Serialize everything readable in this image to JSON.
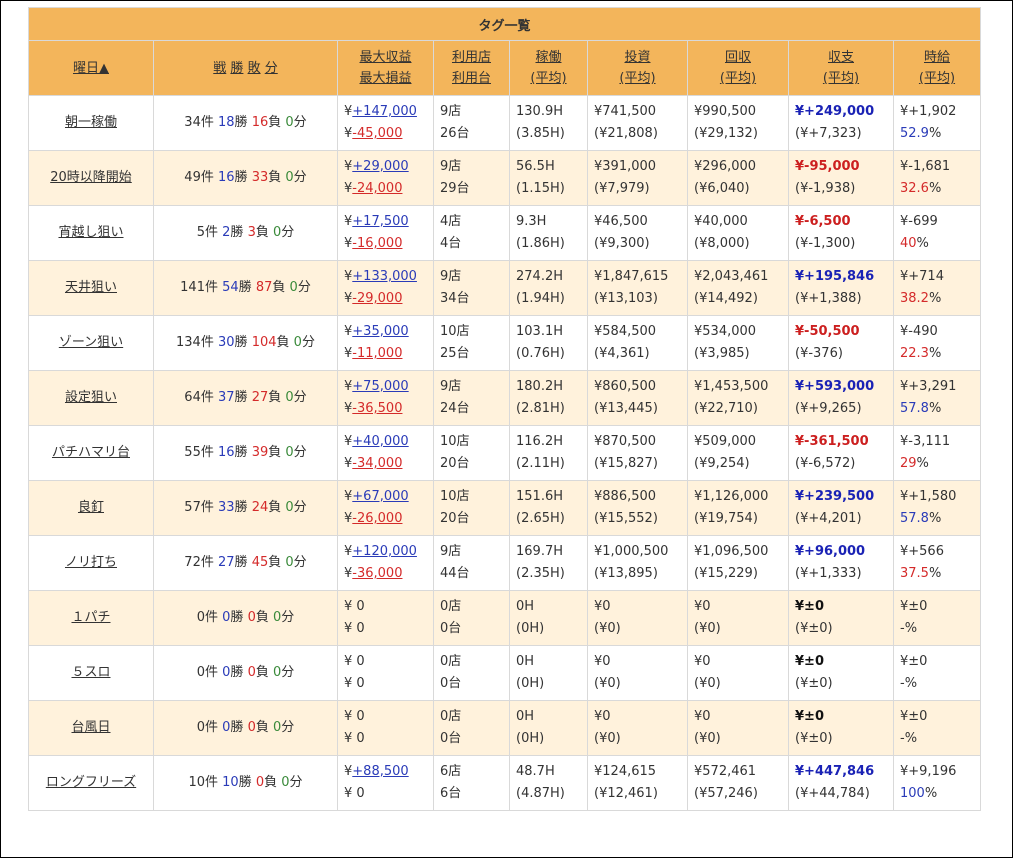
{
  "table_title": "タグ一覧",
  "headers": {
    "day": "曜日▲",
    "record": [
      "戦",
      "勝",
      "敗",
      "分"
    ],
    "max_profit": "最大収益",
    "max_loss": "最大損益",
    "shops": "利用店",
    "machines": "利用台",
    "hours": "稼働",
    "hours_avg": "(平均)",
    "invest": "投資",
    "invest_avg": "(平均)",
    "collect": "回収",
    "collect_avg": "(平均)",
    "balance": "収支",
    "balance_avg": "(平均)",
    "hourly": "時給",
    "hourly_avg": "(平均)"
  },
  "rows": [
    {
      "name": "朝一稼働",
      "games": "34件",
      "wins": "18",
      "losses": "16",
      "draws": "0",
      "max_p": "¥+147,000",
      "max_l": "¥-45,000",
      "shops": "9店",
      "machines": "26台",
      "hours": "130.9H",
      "hours_avg": "(3.85H)",
      "invest": "¥741,500",
      "invest_avg": "(¥21,808)",
      "collect": "¥990,500",
      "collect_avg": "(¥29,132)",
      "balance": "¥+249,000",
      "balance_avg": "(¥+7,323)",
      "hourly": "¥+1,902",
      "rate": "52.9"
    },
    {
      "name": "20時以降開始",
      "games": "49件",
      "wins": "16",
      "losses": "33",
      "draws": "0",
      "max_p": "¥+29,000",
      "max_l": "¥-24,000",
      "shops": "9店",
      "machines": "29台",
      "hours": "56.5H",
      "hours_avg": "(1.15H)",
      "invest": "¥391,000",
      "invest_avg": "(¥7,979)",
      "collect": "¥296,000",
      "collect_avg": "(¥6,040)",
      "balance": "¥-95,000",
      "balance_avg": "(¥-1,938)",
      "hourly": "¥-1,681",
      "rate": "32.6"
    },
    {
      "name": "宵越し狙い",
      "games": "5件",
      "wins": "2",
      "losses": "3",
      "draws": "0",
      "max_p": "¥+17,500",
      "max_l": "¥-16,000",
      "shops": "4店",
      "machines": "4台",
      "hours": "9.3H",
      "hours_avg": "(1.86H)",
      "invest": "¥46,500",
      "invest_avg": "(¥9,300)",
      "collect": "¥40,000",
      "collect_avg": "(¥8,000)",
      "balance": "¥-6,500",
      "balance_avg": "(¥-1,300)",
      "hourly": "¥-699",
      "rate": "40"
    },
    {
      "name": "天井狙い",
      "games": "141件",
      "wins": "54",
      "losses": "87",
      "draws": "0",
      "max_p": "¥+133,000",
      "max_l": "¥-29,000",
      "shops": "9店",
      "machines": "34台",
      "hours": "274.2H",
      "hours_avg": "(1.94H)",
      "invest": "¥1,847,615",
      "invest_avg": "(¥13,103)",
      "collect": "¥2,043,461",
      "collect_avg": "(¥14,492)",
      "balance": "¥+195,846",
      "balance_avg": "(¥+1,388)",
      "hourly": "¥+714",
      "rate": "38.2"
    },
    {
      "name": "ゾーン狙い",
      "games": "134件",
      "wins": "30",
      "losses": "104",
      "draws": "0",
      "max_p": "¥+35,000",
      "max_l": "¥-11,000",
      "shops": "10店",
      "machines": "25台",
      "hours": "103.1H",
      "hours_avg": "(0.76H)",
      "invest": "¥584,500",
      "invest_avg": "(¥4,361)",
      "collect": "¥534,000",
      "collect_avg": "(¥3,985)",
      "balance": "¥-50,500",
      "balance_avg": "(¥-376)",
      "hourly": "¥-490",
      "rate": "22.3"
    },
    {
      "name": "設定狙い",
      "games": "64件",
      "wins": "37",
      "losses": "27",
      "draws": "0",
      "max_p": "¥+75,000",
      "max_l": "¥-36,500",
      "shops": "9店",
      "machines": "24台",
      "hours": "180.2H",
      "hours_avg": "(2.81H)",
      "invest": "¥860,500",
      "invest_avg": "(¥13,445)",
      "collect": "¥1,453,500",
      "collect_avg": "(¥22,710)",
      "balance": "¥+593,000",
      "balance_avg": "(¥+9,265)",
      "hourly": "¥+3,291",
      "rate": "57.8"
    },
    {
      "name": "パチハマリ台",
      "games": "55件",
      "wins": "16",
      "losses": "39",
      "draws": "0",
      "max_p": "¥+40,000",
      "max_l": "¥-34,000",
      "shops": "10店",
      "machines": "20台",
      "hours": "116.2H",
      "hours_avg": "(2.11H)",
      "invest": "¥870,500",
      "invest_avg": "(¥15,827)",
      "collect": "¥509,000",
      "collect_avg": "(¥9,254)",
      "balance": "¥-361,500",
      "balance_avg": "(¥-6,572)",
      "hourly": "¥-3,111",
      "rate": "29"
    },
    {
      "name": "良釘",
      "games": "57件",
      "wins": "33",
      "losses": "24",
      "draws": "0",
      "max_p": "¥+67,000",
      "max_l": "¥-26,000",
      "shops": "10店",
      "machines": "20台",
      "hours": "151.6H",
      "hours_avg": "(2.65H)",
      "invest": "¥886,500",
      "invest_avg": "(¥15,552)",
      "collect": "¥1,126,000",
      "collect_avg": "(¥19,754)",
      "balance": "¥+239,500",
      "balance_avg": "(¥+4,201)",
      "hourly": "¥+1,580",
      "rate": "57.8"
    },
    {
      "name": "ノリ打ち",
      "games": "72件",
      "wins": "27",
      "losses": "45",
      "draws": "0",
      "max_p": "¥+120,000",
      "max_l": "¥-36,000",
      "shops": "9店",
      "machines": "44台",
      "hours": "169.7H",
      "hours_avg": "(2.35H)",
      "invest": "¥1,000,500",
      "invest_avg": "(¥13,895)",
      "collect": "¥1,096,500",
      "collect_avg": "(¥15,229)",
      "balance": "¥+96,000",
      "balance_avg": "(¥+1,333)",
      "hourly": "¥+566",
      "rate": "37.5"
    },
    {
      "name": "１パチ",
      "games": "0件",
      "wins": "0",
      "losses": "0",
      "draws": "0",
      "max_p": "¥ 0",
      "max_l": "¥ 0",
      "shops": "0店",
      "machines": "0台",
      "hours": "0H",
      "hours_avg": "(0H)",
      "invest": "¥0",
      "invest_avg": "(¥0)",
      "collect": "¥0",
      "collect_avg": "(¥0)",
      "balance": "¥±0",
      "balance_avg": "(¥±0)",
      "hourly": "¥±0",
      "rate": "-"
    },
    {
      "name": "５スロ",
      "games": "0件",
      "wins": "0",
      "losses": "0",
      "draws": "0",
      "max_p": "¥ 0",
      "max_l": "¥ 0",
      "shops": "0店",
      "machines": "0台",
      "hours": "0H",
      "hours_avg": "(0H)",
      "invest": "¥0",
      "invest_avg": "(¥0)",
      "collect": "¥0",
      "collect_avg": "(¥0)",
      "balance": "¥±0",
      "balance_avg": "(¥±0)",
      "hourly": "¥±0",
      "rate": "-"
    },
    {
      "name": "台風日",
      "games": "0件",
      "wins": "0",
      "losses": "0",
      "draws": "0",
      "max_p": "¥ 0",
      "max_l": "¥ 0",
      "shops": "0店",
      "machines": "0台",
      "hours": "0H",
      "hours_avg": "(0H)",
      "invest": "¥0",
      "invest_avg": "(¥0)",
      "collect": "¥0",
      "collect_avg": "(¥0)",
      "balance": "¥±0",
      "balance_avg": "(¥±0)",
      "hourly": "¥±0",
      "rate": "-"
    },
    {
      "name": "ロングフリーズ",
      "games": "10件",
      "wins": "10",
      "losses": "0",
      "draws": "0",
      "max_p": "¥+88,500",
      "max_l": "¥ 0",
      "shops": "6店",
      "machines": "6台",
      "hours": "48.7H",
      "hours_avg": "(4.87H)",
      "invest": "¥124,615",
      "invest_avg": "(¥12,461)",
      "collect": "¥572,461",
      "collect_avg": "(¥57,246)",
      "balance": "¥+447,846",
      "balance_avg": "(¥+44,784)",
      "hourly": "¥+9,196",
      "rate": "100"
    }
  ],
  "labels": {
    "win": "勝",
    "loss": "負",
    "draw": "分",
    "pct": "%"
  },
  "colors": {
    "header_bg": "#f3b55b",
    "row_alt_bg": "#fff2dc",
    "positive": "#1a22b5",
    "negative": "#cc1f1f",
    "draw": "#3a8a3a"
  }
}
